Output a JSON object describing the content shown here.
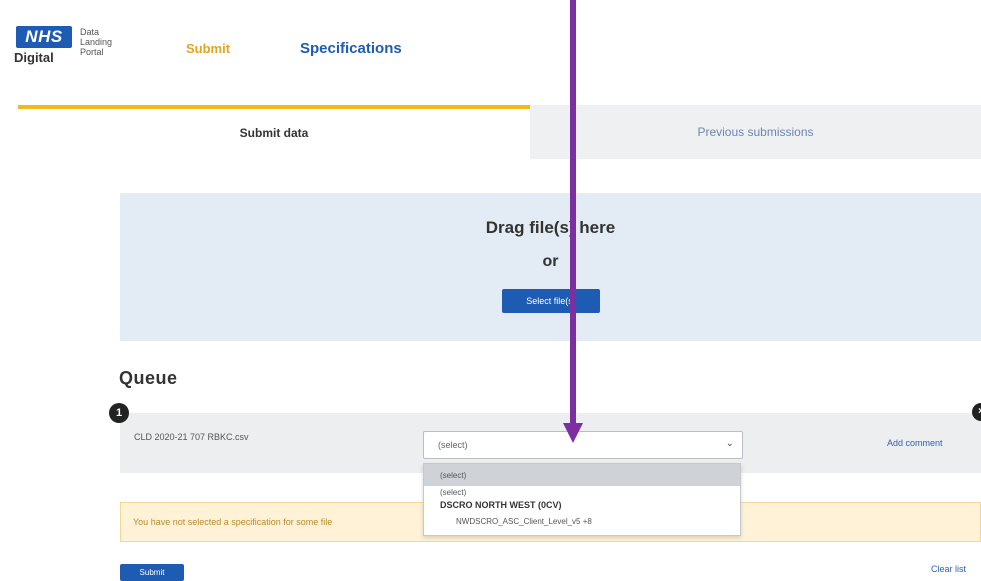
{
  "header": {
    "logo_text": "NHS",
    "logo_sub": "Digital",
    "portal_lines": [
      "Data",
      "Landing",
      "Portal"
    ],
    "nav": {
      "submit": "Submit",
      "specifications": "Specifications"
    }
  },
  "tabs": {
    "active": "Submit data",
    "inactive": "Previous submissions"
  },
  "dropzone": {
    "title": "Drag file(s) here",
    "or": "or",
    "button": "Select file(s)"
  },
  "queue": {
    "title": "Queue",
    "badge": "1",
    "row": {
      "file_name": "CLD 2020-21 707 RBKC.csv",
      "select_value": "(select)",
      "add_comment": "Add comment"
    }
  },
  "dropdown": {
    "selected": "(select)",
    "options": [
      "(select)"
    ],
    "group_label": "DSCRO NORTH WEST (0CV)",
    "group_option": "NWDSCRO_ASC_Client_Level_v5 +8"
  },
  "warning": "You have not selected a specification for some file",
  "footer": {
    "submit": "Submit",
    "clear": "Clear list"
  },
  "colors": {
    "nhs_blue": "#1e5cb3",
    "tab_accent": "#f0b91d",
    "annotation_arrow": "#7b2fa0"
  }
}
